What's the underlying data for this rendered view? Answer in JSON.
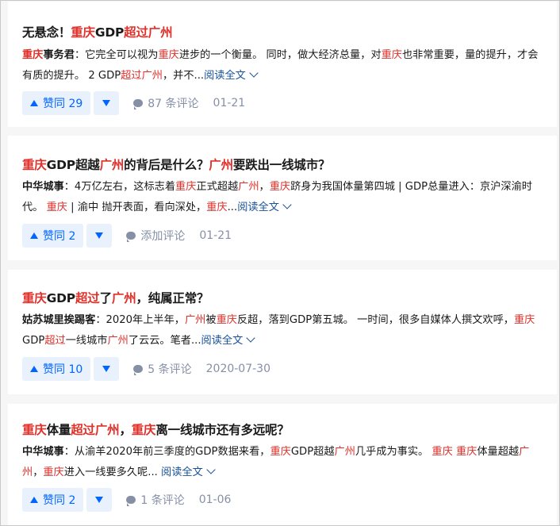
{
  "answers": [
    {
      "title": [
        {
          "t": "无悬念！",
          "hl": false
        },
        {
          "t": "重庆",
          "hl": true
        },
        {
          "t": "GDP",
          "hl": false
        },
        {
          "t": "超过",
          "hl": true
        },
        {
          "t": "广州",
          "hl": true
        }
      ],
      "excerpt": [
        {
          "t": "重庆",
          "hl": true,
          "b": true
        },
        {
          "t": "事务君",
          "hl": false,
          "b": true
        },
        {
          "t": "：它完全可以视为",
          "hl": false
        },
        {
          "t": "重庆",
          "hl": true
        },
        {
          "t": "进步的一个衡量。 同时，做大经济总量，对",
          "hl": false
        },
        {
          "t": "重庆",
          "hl": true
        },
        {
          "t": "也非常重要，量的提升，才会有质的提升。 2 GDP",
          "hl": false
        },
        {
          "t": "超过",
          "hl": true
        },
        {
          "t": "广州",
          "hl": true
        },
        {
          "t": "，并不...",
          "hl": false
        }
      ],
      "read_more": "阅读全文",
      "vote_label": "赞同 29",
      "comment_label": "87 条评论",
      "date": "01-21"
    },
    {
      "title": [
        {
          "t": "重庆",
          "hl": true
        },
        {
          "t": "GDP超越",
          "hl": false
        },
        {
          "t": "广州",
          "hl": true
        },
        {
          "t": "的背后是什么？",
          "hl": false
        },
        {
          "t": "广州",
          "hl": true
        },
        {
          "t": "要跌出一线城市？",
          "hl": false
        }
      ],
      "excerpt": [
        {
          "t": "中华城事",
          "hl": false,
          "b": true
        },
        {
          "t": "：4万亿左右，这标志着",
          "hl": false
        },
        {
          "t": "重庆",
          "hl": true
        },
        {
          "t": "正式超越",
          "hl": false
        },
        {
          "t": "广州",
          "hl": true
        },
        {
          "t": "，",
          "hl": false
        },
        {
          "t": "重庆",
          "hl": true
        },
        {
          "t": "跻身为我国体量第四城 | GDP总量进入：京沪深渝时代。 ",
          "hl": false
        },
        {
          "t": "重庆",
          "hl": true
        },
        {
          "t": " | 渝中 抛开表面，看向深处，",
          "hl": false
        },
        {
          "t": "重庆",
          "hl": true
        },
        {
          "t": "...",
          "hl": false
        }
      ],
      "read_more": "阅读全文",
      "vote_label": "赞同 2",
      "comment_label": "添加评论",
      "date": "01-21"
    },
    {
      "title": [
        {
          "t": "重庆",
          "hl": true
        },
        {
          "t": "GDP",
          "hl": false
        },
        {
          "t": "超过",
          "hl": true
        },
        {
          "t": "了",
          "hl": false
        },
        {
          "t": "广州",
          "hl": true
        },
        {
          "t": "，纯属正常？",
          "hl": false
        }
      ],
      "excerpt": [
        {
          "t": "姑苏城里挨踢客",
          "hl": false,
          "b": true
        },
        {
          "t": "：2020年上半年，",
          "hl": false
        },
        {
          "t": "广州",
          "hl": true
        },
        {
          "t": "被",
          "hl": false
        },
        {
          "t": "重庆",
          "hl": true
        },
        {
          "t": "反超，落到GDP第五城。 一时间，很多自媒体人撰文欢呼，",
          "hl": false
        },
        {
          "t": "重庆",
          "hl": true
        },
        {
          "t": "GDP",
          "hl": false
        },
        {
          "t": "超过",
          "hl": true
        },
        {
          "t": "一线城市",
          "hl": false
        },
        {
          "t": "广州",
          "hl": true
        },
        {
          "t": "了云云。笔者...",
          "hl": false
        }
      ],
      "read_more": "阅读全文",
      "vote_label": "赞同 10",
      "comment_label": "5 条评论",
      "date": "2020-07-30"
    },
    {
      "title": [
        {
          "t": "重庆",
          "hl": true
        },
        {
          "t": "体量",
          "hl": false
        },
        {
          "t": "超过",
          "hl": true
        },
        {
          "t": "广州",
          "hl": true
        },
        {
          "t": "，",
          "hl": false
        },
        {
          "t": "重庆",
          "hl": true
        },
        {
          "t": "离一线城市还有多远呢？",
          "hl": false
        }
      ],
      "excerpt": [
        {
          "t": "中华城事",
          "hl": false,
          "b": true
        },
        {
          "t": "：从渝羊2020年前三季度的GDP数据来看，",
          "hl": false
        },
        {
          "t": "重庆",
          "hl": true
        },
        {
          "t": "GDP超越",
          "hl": false
        },
        {
          "t": "广州",
          "hl": true
        },
        {
          "t": "几乎成为事实。 ",
          "hl": false
        },
        {
          "t": "重庆",
          "hl": true
        },
        {
          "t": " ",
          "hl": false
        },
        {
          "t": "重庆",
          "hl": true
        },
        {
          "t": "体量超越",
          "hl": false
        },
        {
          "t": "广州",
          "hl": true
        },
        {
          "t": "，",
          "hl": false
        },
        {
          "t": "重庆",
          "hl": true
        },
        {
          "t": "进入一线要多久呢... ",
          "hl": false
        }
      ],
      "read_more": "阅读全文",
      "vote_label": "赞同 2",
      "comment_label": "1 条评论",
      "date": "01-06"
    }
  ],
  "colors": {
    "highlight": "#e0302a",
    "link": "#175199",
    "vote": "#0066ff",
    "meta": "#8590a6"
  }
}
